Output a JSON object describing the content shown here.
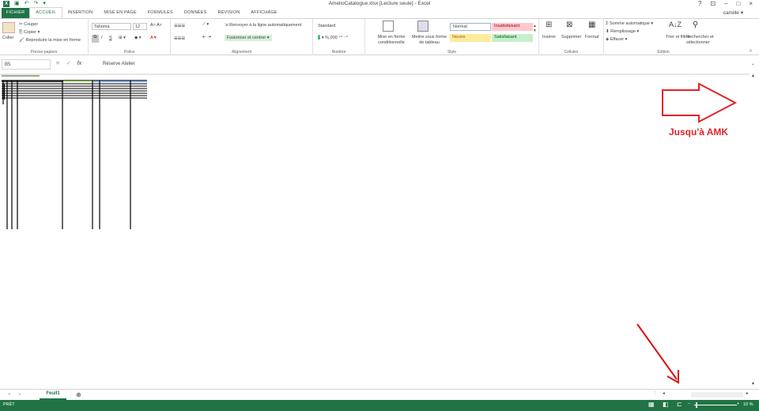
{
  "app": {
    "title": "AmelioCatalogue.xlsx [Lecture seule] - Excel",
    "user": "camille",
    "window_controls": [
      "?",
      "⊡",
      "–",
      "□",
      "×"
    ]
  },
  "tabs": [
    {
      "label": "FICHIER"
    },
    {
      "label": "ACCUEIL"
    },
    {
      "label": "INSERTION"
    },
    {
      "label": "MISE EN PAGE"
    },
    {
      "label": "FORMULES"
    },
    {
      "label": "DONNÉES"
    },
    {
      "label": "RÉVISION"
    },
    {
      "label": "AFFICHAGE"
    }
  ],
  "ribbon": {
    "clipboard": {
      "paste": "Coller",
      "cut": "Couper",
      "copy": "Copier",
      "format_painter": "Reproduire la mise en forme",
      "label": "Presse-papiers"
    },
    "font": {
      "name": "Tahoma",
      "size": "12",
      "bold": "G",
      "italic": "I",
      "underline": "S",
      "label": "Police"
    },
    "alignment": {
      "wrap": "Renvoyer à la ligne automatiquement",
      "merge": "Fusionner et centrer",
      "label": "Alignement"
    },
    "number": {
      "format": "Standard",
      "label": "Nombre"
    },
    "styles": {
      "conditional": "Mise en forme conditionnelle",
      "as_table": "Mettre sous forme de tableau",
      "normal": "Normal",
      "bad": "Insatisfaisant",
      "neutral": "Neutre",
      "good": "Satisfaisant",
      "label": "Style"
    },
    "cells": {
      "insert": "Insérer",
      "delete": "Supprimer",
      "format": "Format",
      "label": "Cellules"
    },
    "editing": {
      "autosum": "Somme automatique",
      "fill": "Remplissage",
      "clear": "Effacer",
      "sort": "Trier et filtrer",
      "find": "Rechercher et sélectionner",
      "label": "Édition"
    }
  },
  "formula_bar": {
    "cell_ref": "B5",
    "fx": "fx",
    "value": "Réserve Atelier"
  },
  "sheet": {
    "tab": "Feuil1",
    "add": "⊕"
  },
  "status": {
    "left": "PRÊT",
    "zoom": "10 %"
  },
  "annotation": {
    "text": "Jusqu'à AMK"
  },
  "colors": {
    "brand": "#217346",
    "annotation": "#e0242a",
    "style_normal": "#ffffff",
    "style_bad": "#ffc7ce",
    "style_neutral": "#ffeb9c",
    "style_good": "#c6efce"
  }
}
